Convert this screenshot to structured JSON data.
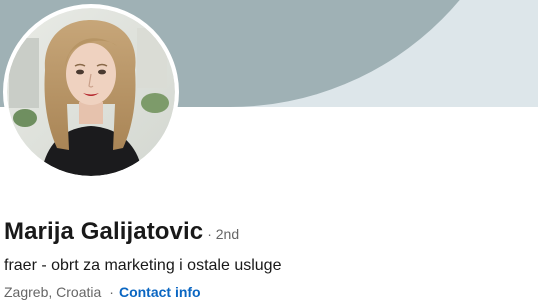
{
  "profile": {
    "name": "Marija Galijatovic",
    "degree": "· 2nd",
    "headline": "fraer - obrt za marketing i ostale usluge",
    "location": "Zagreb, Croatia",
    "separator": "·",
    "contact_label": "Contact info"
  },
  "colors": {
    "banner_background": "#dde6ea",
    "banner_shape": "#9fb1b5",
    "link": "#0a66c2",
    "text_primary": "#191919",
    "text_secondary": "#666666"
  },
  "icons": {
    "avatar": "profile-photo"
  }
}
